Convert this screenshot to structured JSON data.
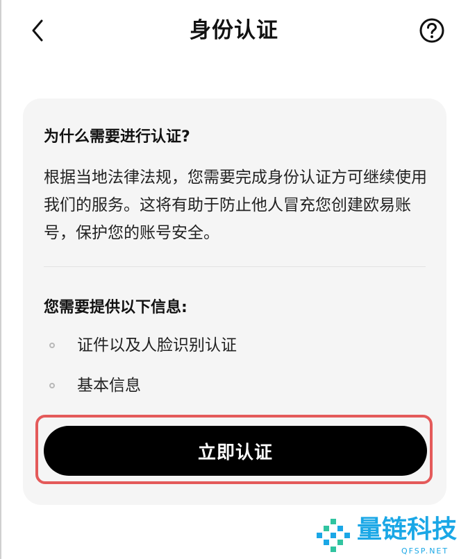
{
  "header": {
    "title": "身份认证",
    "back_icon": "chevron-left-icon",
    "help_icon": "question-circle-icon"
  },
  "card": {
    "why_heading": "为什么需要进行认证?",
    "why_text": "根据当地法律法规，您需要完成身份认证方可继续使用我们的服务。这将有助于防止他人冒充您创建欧易账号，保护您的账号安全。",
    "need_heading": "您需要提供以下信息:",
    "items": [
      "证件以及人脸识别认证",
      "基本信息"
    ],
    "verify_button_label": "立即认证"
  },
  "watermark": {
    "text": "量链科技",
    "subtext": "QFSP.NET"
  },
  "colors": {
    "accent_button": "#000000",
    "highlight": "#e45a5a",
    "card_background": "#f5f5f5",
    "watermark": "#1aa7e6"
  }
}
